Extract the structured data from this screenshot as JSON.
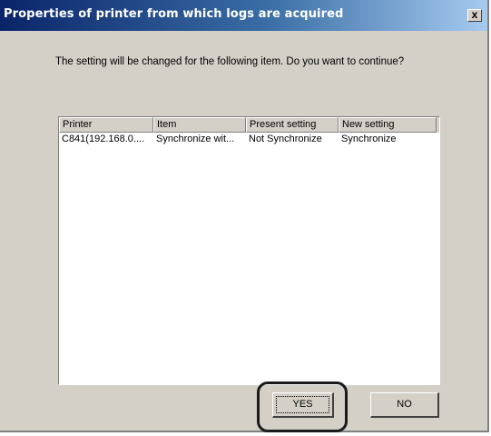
{
  "window": {
    "title": "Properties of printer from which logs are acquired",
    "close_glyph": "x"
  },
  "message": "The setting will be changed for the following item. Do you want to continue?",
  "list": {
    "columns": [
      "Printer",
      "Item",
      "Present setting",
      "New setting"
    ],
    "rows": [
      [
        "C841(192.168.0....",
        "Synchronize wit...",
        "Not Synchronize",
        "Synchronize"
      ]
    ]
  },
  "buttons": {
    "yes": "YES",
    "no": "NO"
  }
}
